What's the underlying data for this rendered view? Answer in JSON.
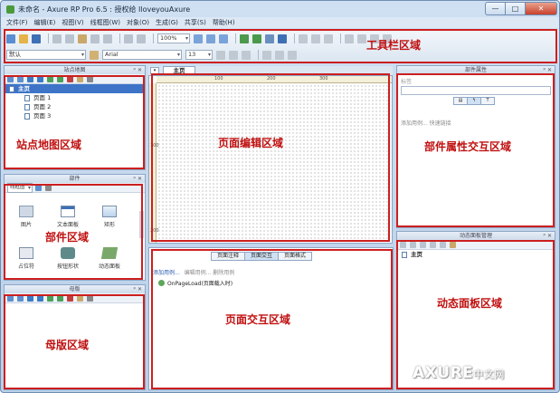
{
  "window": {
    "title": "未命名 - Axure RP Pro 6.5 : 授权给 IloveyouAxure"
  },
  "menu": [
    "文件(F)",
    "编辑(E)",
    "视图(V)",
    "线框图(W)",
    "对象(O)",
    "生成(G)",
    "共享(S)",
    "帮助(H)"
  ],
  "toolbar": {
    "zoom": "100%",
    "style": "默认",
    "font": "Arial",
    "font_size": "13"
  },
  "sitemap": {
    "title": "站点地图",
    "items": [
      "主页",
      "页面 1",
      "页面 2",
      "页面 3"
    ]
  },
  "widgets": {
    "title": "部件",
    "library": "线框图",
    "items": [
      "图片",
      "文本面板",
      "矩形",
      "占位符",
      "按钮形状",
      "动态面板"
    ]
  },
  "masters": {
    "title": "母版"
  },
  "canvas": {
    "tab": "主页",
    "ruler_top": [
      "100",
      "200",
      "300"
    ],
    "ruler_left": [
      "100",
      "200"
    ]
  },
  "interactions": {
    "tabs": [
      "页面注释",
      "页面交互",
      "页面格式"
    ],
    "add_case": "添加用例...",
    "links": "编辑用例...  删除用例",
    "event": "OnPageLoad(页面载入时)"
  },
  "properties": {
    "title": "部件属性",
    "label_placeholder": "标签",
    "add_case": "添加用例...  快速链接"
  },
  "dynamic_panel": {
    "title": "动态面板管理",
    "item": "主页"
  },
  "annotations": {
    "toolbar": "工具栏区域",
    "sitemap": "站点地图区域",
    "widgets": "部件区域",
    "masters": "母版区域",
    "canvas": "页面编辑区域",
    "interactions": "页面交互区域",
    "properties": "部件属性交互区域",
    "dynamic_panel": "动态面板区域"
  },
  "watermark": {
    "main": "AXURE",
    "sub": "中文网"
  },
  "colors": {
    "annotation_red": "#cc1f1f",
    "selection_blue": "#3d74c8",
    "chrome_blue": "#cfe0f2"
  }
}
